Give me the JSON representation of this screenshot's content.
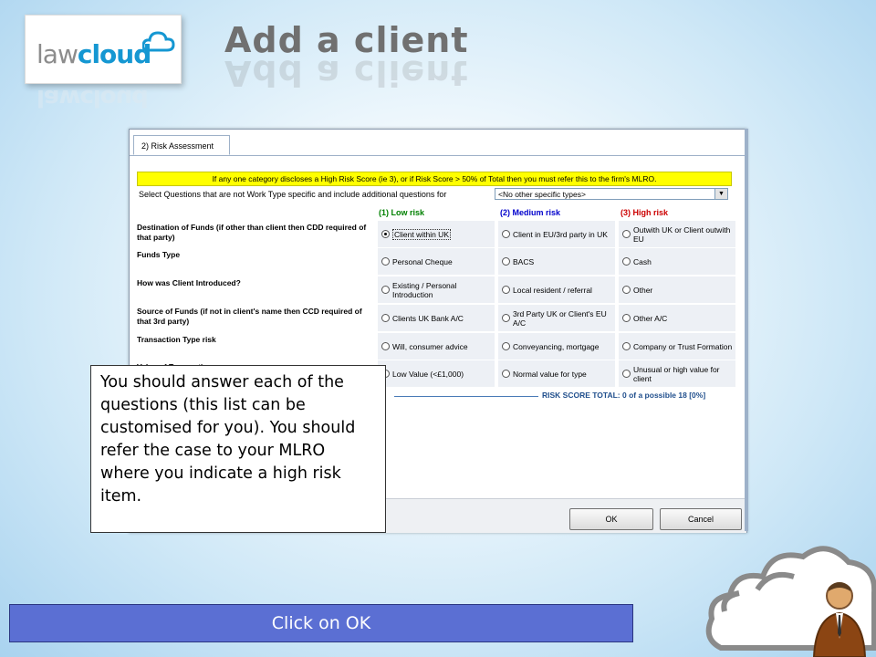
{
  "logo": {
    "part1": "law",
    "part2": "cloud"
  },
  "title": "Add a client",
  "dialog": {
    "tab": "2) Risk Assessment",
    "warning": "If any one category discloses a High Risk Score (ie 3), or if  Risk Score > 50% of Total then you must refer this to the firm's MLRO.",
    "select_label": "Select Questions that are not Work Type specific and include additional questions for",
    "select_value": "<No other specific types>",
    "columns": {
      "low": {
        "label": "(1) Low risk",
        "color": "#008000"
      },
      "medium": {
        "label": "(2) Medium risk",
        "color": "#0000cc"
      },
      "high": {
        "label": "(3) High risk",
        "color": "#cc0000"
      }
    },
    "rows": [
      {
        "question": "Destination of Funds (if other than client then CDD required of that party)",
        "low": "Client within UK",
        "medium": "Client in EU/3rd party in UK",
        "high": "Outwith UK or Client outwith EU",
        "selected": "low"
      },
      {
        "question": "Funds Type",
        "low": "Personal Cheque",
        "medium": "BACS",
        "high": "Cash",
        "selected": ""
      },
      {
        "question": "How was Client Introduced?",
        "low": "Existing / Personal Introduction",
        "medium": "Local resident / referral",
        "high": "Other",
        "selected": ""
      },
      {
        "question": "Source of Funds (if not in client's name then CCD required of that 3rd party)",
        "low": "Clients UK Bank A/C",
        "medium": "3rd Party UK or Client's EU A/C",
        "high": "Other A/C",
        "selected": ""
      },
      {
        "question": "Transaction Type risk",
        "low": "Will, consumer advice",
        "medium": "Conveyancing, mortgage",
        "high": "Company or Trust Formation",
        "selected": ""
      },
      {
        "question": "Value of Transaction",
        "low": "Low Value (<£1,000)",
        "medium": "Normal value for type",
        "high": "Unusual or high value  for client",
        "selected": ""
      }
    ],
    "total": "RISK SCORE TOTAL: 0 of a possible 18 [0%]",
    "ok_label": "OK",
    "cancel_label": "Cancel"
  },
  "callout": "You should answer each of the questions (this list can be customised for you). You should refer the case to your MLRO where you indicate a high risk item.",
  "cta": "Click on OK"
}
